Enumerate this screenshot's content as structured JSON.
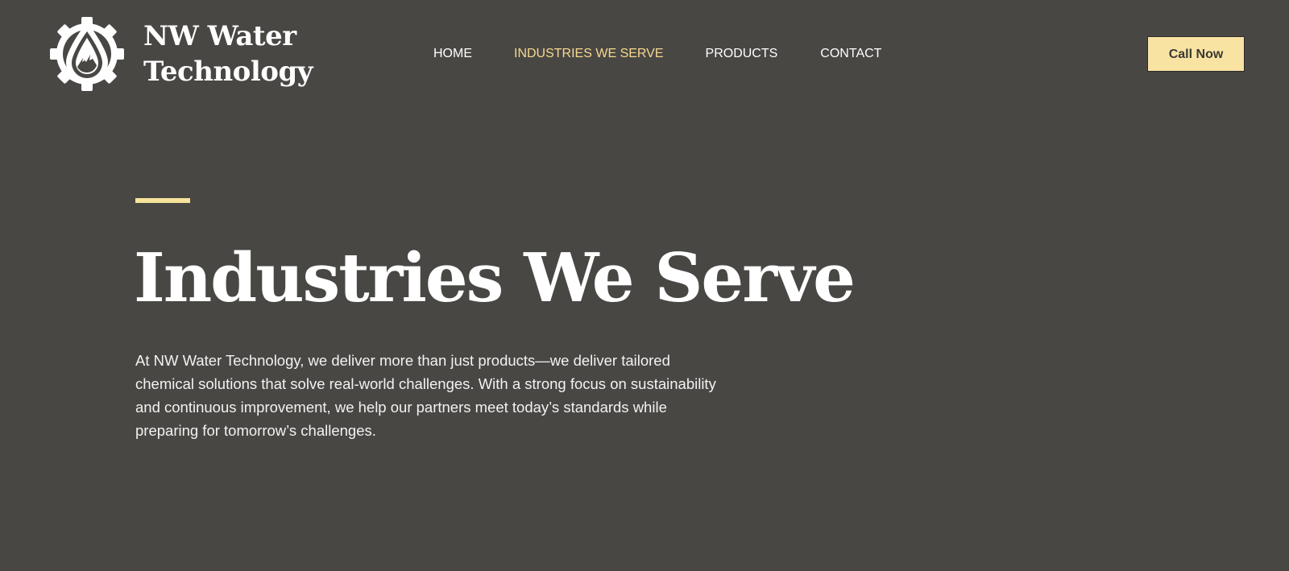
{
  "brand": {
    "name_line1": "NW Water",
    "name_line2": "Technology",
    "logo_icon": "gear-water-drop-icon"
  },
  "nav": {
    "items": [
      {
        "label": "HOME",
        "active": false
      },
      {
        "label": "INDUSTRIES WE SERVE",
        "active": true
      },
      {
        "label": "PRODUCTS",
        "active": false
      },
      {
        "label": "CONTACT",
        "active": false
      }
    ]
  },
  "header": {
    "cta_label": "Call Now"
  },
  "hero": {
    "title": "Industries We Serve",
    "description": "At NW Water Technology, we deliver more than just products—we deliver tailored chemical solutions that solve real-world challenges. With a strong focus on sustainability and continuous improvement, we help our partners meet today’s standards while preparing for tomorrow’s challenges."
  },
  "colors": {
    "background": "#494744",
    "accent": "#f6d98f",
    "button_bg": "#f9e3a3",
    "text": "#ffffff"
  }
}
